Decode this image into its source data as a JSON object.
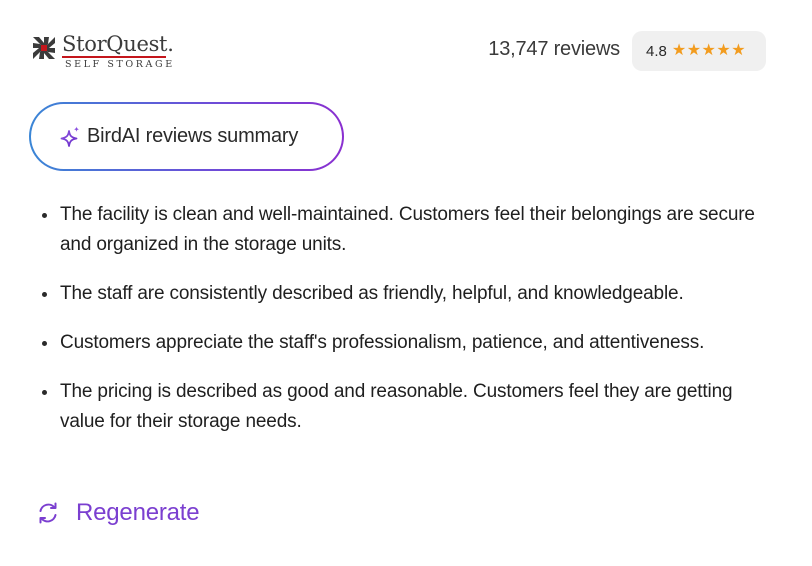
{
  "header": {
    "logo_name": "StorQuest.",
    "logo_tagline": "SELF STORAGE",
    "review_count": "13,747 reviews",
    "rating": "4.8",
    "stars": 5
  },
  "summary_button": {
    "label": "BirdAI reviews summary",
    "icon": "sparkle-icon"
  },
  "summary": {
    "items": [
      "The facility is clean and well-maintained. Customers feel their belongings are secure and organized in the storage units.",
      "The staff are consistently described as friendly, helpful, and knowledgeable.",
      "Customers appreciate the staff's professionalism, patience, and attentiveness.",
      "The pricing is described as good and reasonable. Customers feel they are getting value for their storage needs."
    ]
  },
  "regenerate": {
    "label": "Regenerate",
    "icon": "refresh-icon"
  },
  "colors": {
    "accent_purple": "#7b3fd0",
    "star_orange": "#f29c1f",
    "logo_red": "#c4161c",
    "pill_bg": "#f0f0f0"
  }
}
